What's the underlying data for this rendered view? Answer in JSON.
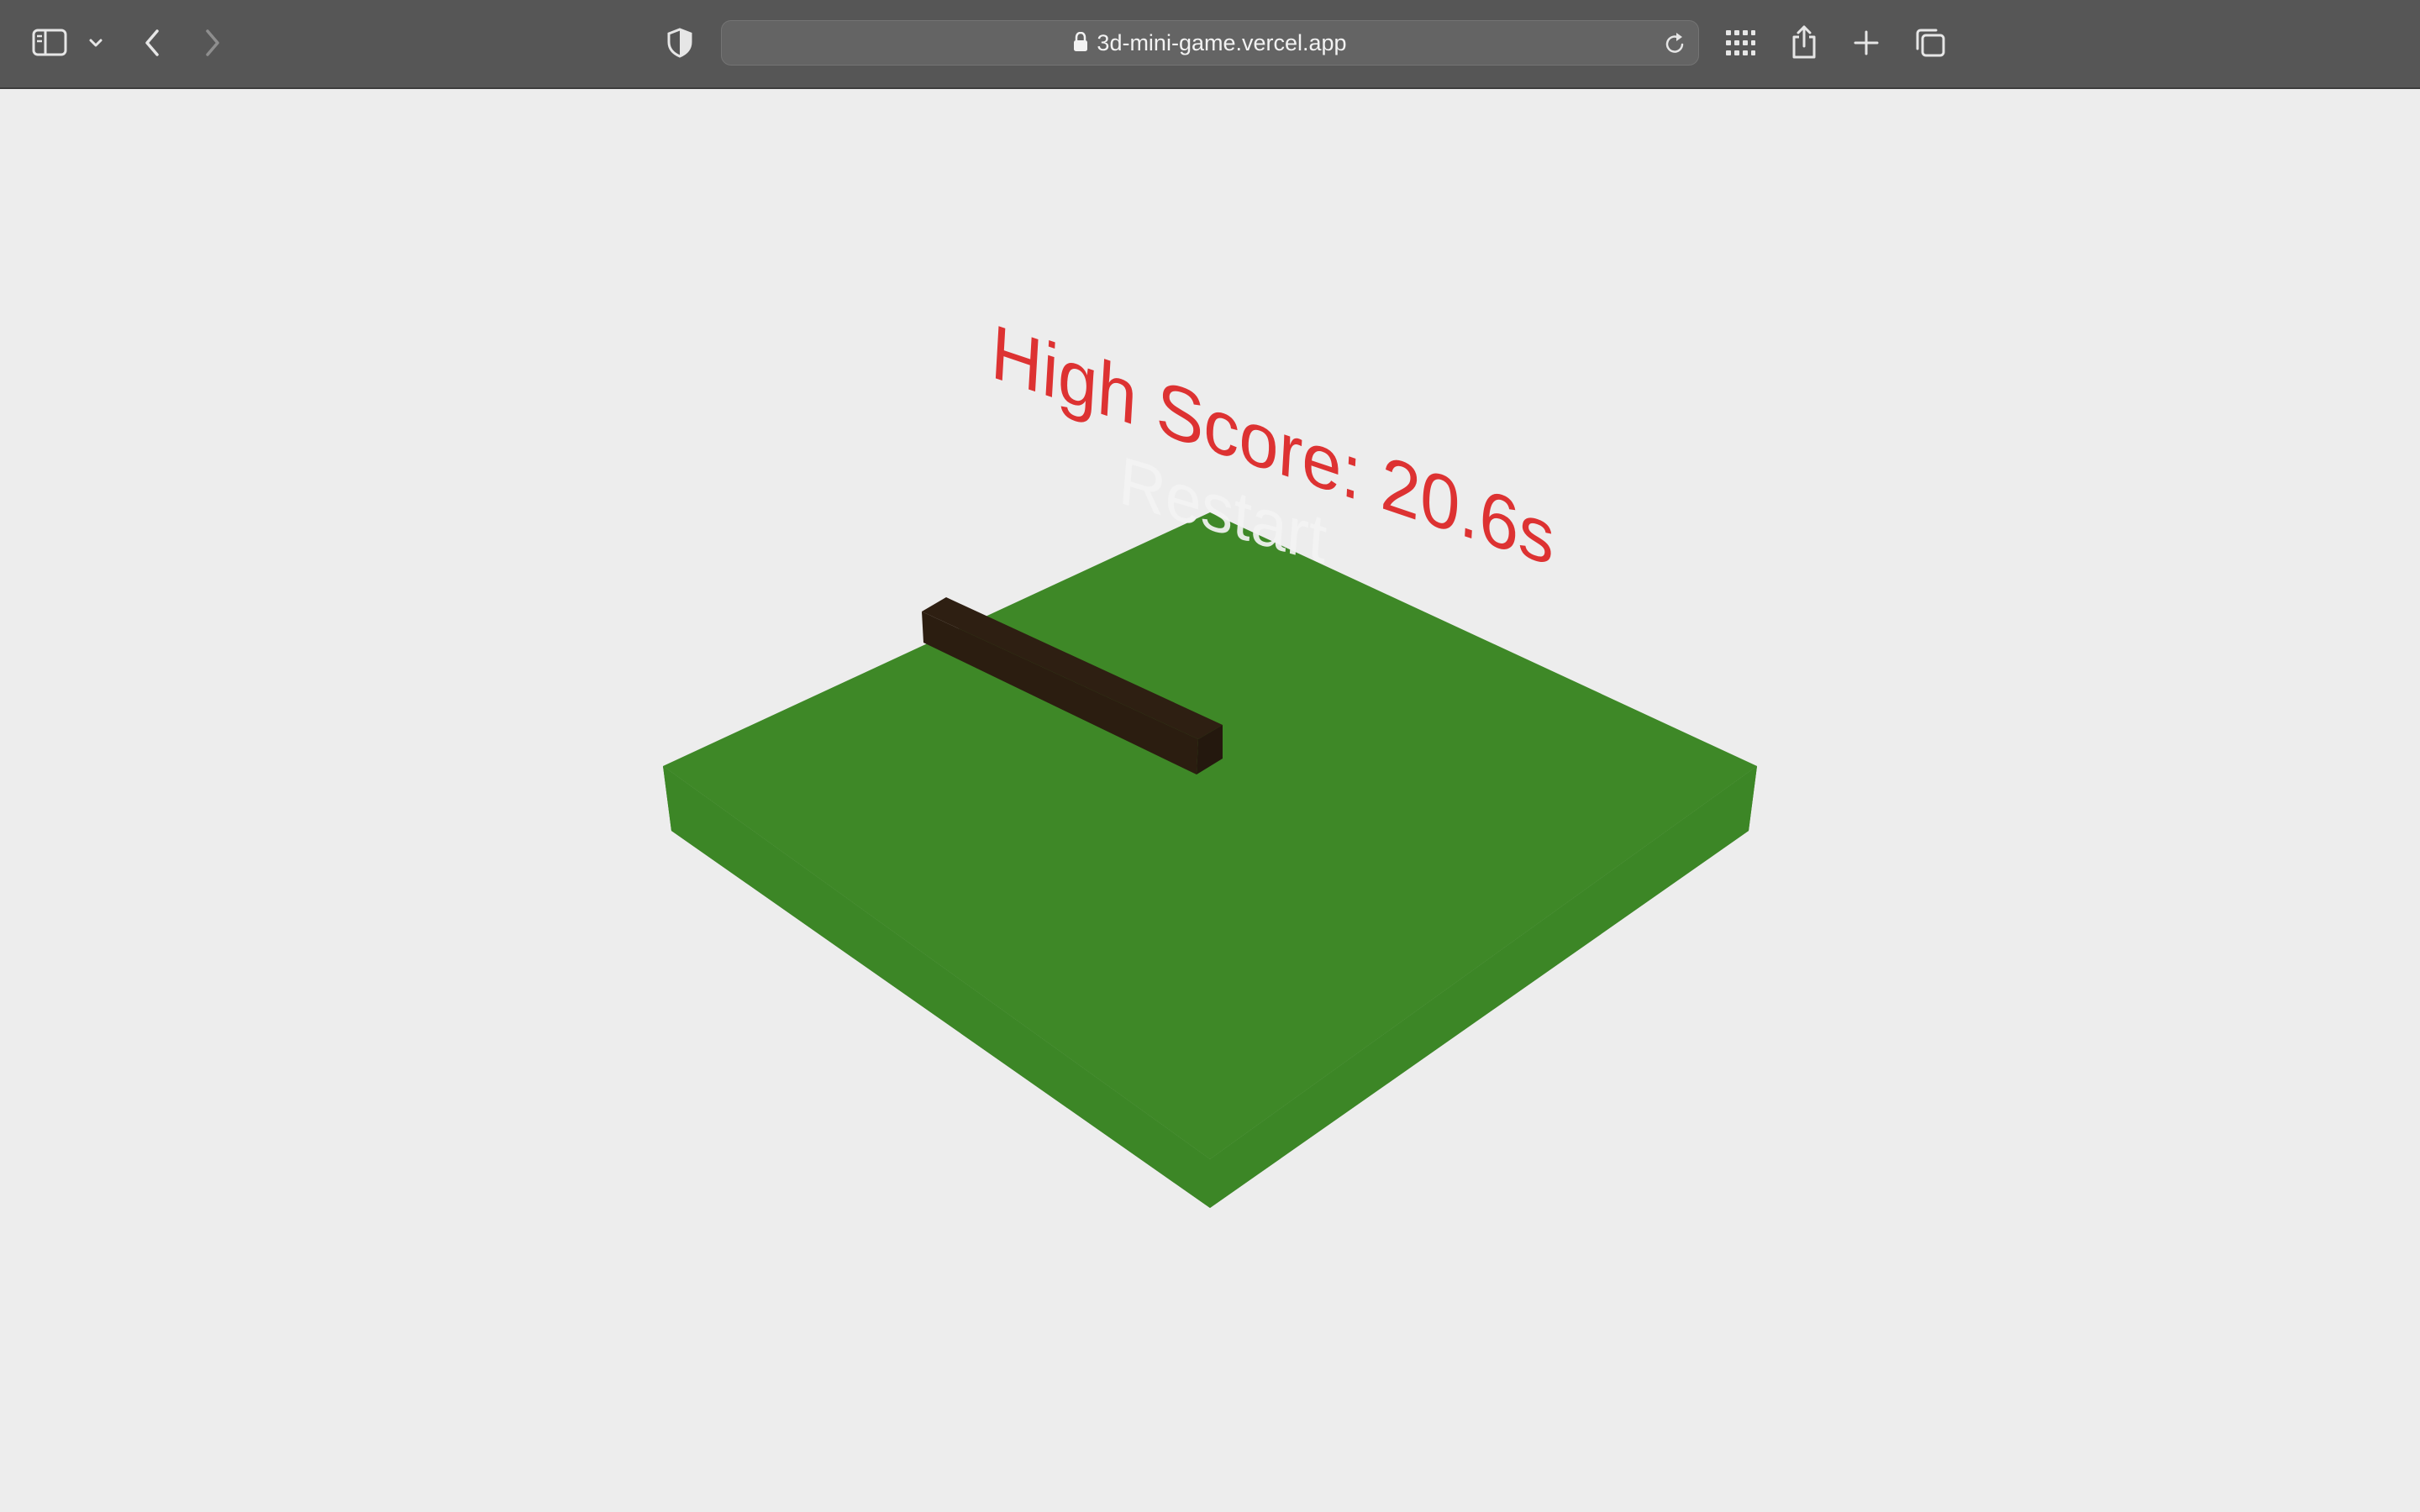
{
  "browser": {
    "url": "3d-mini-game.vercel.app",
    "icons": {
      "sidebar": "sidebar-icon",
      "sidebar_menu": "chevron-down-icon",
      "back": "chevron-left-icon",
      "forward": "chevron-right-icon",
      "privacy": "shield-icon",
      "lock": "lock-icon",
      "reload": "reload-icon",
      "grid": "grid-icon",
      "share": "share-icon",
      "new_tab": "plus-icon",
      "tabs": "tabs-overview-icon"
    }
  },
  "game": {
    "high_score_label": "High Score: 20.6s",
    "restart_label": "Restart",
    "colors": {
      "background": "#ededed",
      "ground_top": "#3e8827",
      "ground_side": "#387b23",
      "obstacle": "#2e1f12",
      "obstacle_side": "#24180e",
      "high_score_text": "#dd3232",
      "restart_text": "#f4f4f4"
    }
  }
}
